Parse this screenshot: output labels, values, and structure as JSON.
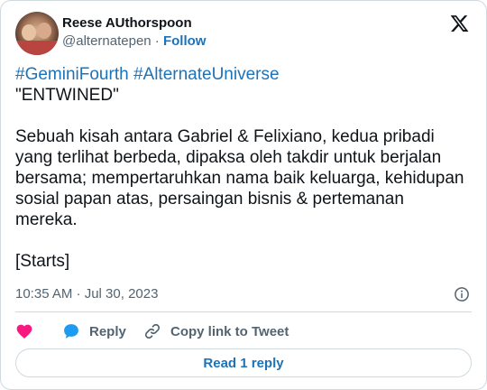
{
  "author": {
    "display_name": "Reese AUthorspoon",
    "handle": "@alternatepen",
    "separator": " · ",
    "follow_label": "Follow"
  },
  "tweet": {
    "hashtag1": "#GeminiFourth",
    "hashtag2": "#AlternateUniverse",
    "title": "\"ENTWINED\"",
    "paragraph": "Sebuah kisah antara Gabriel & Felixiano, kedua pribadi yang terlihat berbeda, dipaksa oleh takdir untuk berjalan bersama; mempertaruhkan nama baik keluarga, kehidupan sosial papan atas, persaingan bisnis & pertemanan mereka.",
    "closing": "[Starts]",
    "timestamp": "10:35 AM · Jul 30, 2023"
  },
  "actions": {
    "reply_label": "Reply",
    "copy_link_label": "Copy link to Tweet"
  },
  "read_replies_label": "Read 1 reply",
  "icons": {
    "like": "heart-icon",
    "reply": "speech-bubble-icon",
    "copy": "link-icon",
    "info": "info-icon",
    "brand": "x-logo-icon"
  },
  "colors": {
    "link": "#1d72b8",
    "like": "#f91880",
    "reply": "#1d9bf0",
    "muted": "#536471",
    "border": "#cfd9de"
  }
}
